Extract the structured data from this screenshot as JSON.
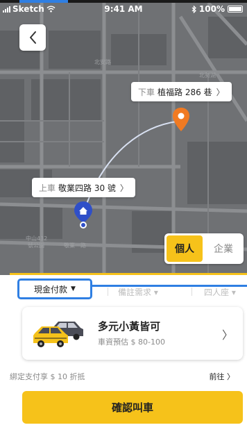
{
  "status_bar": {
    "carrier": "Sketch",
    "time": "9:41 AM",
    "battery": "100%"
  },
  "map": {
    "dropoff": {
      "label": "下車",
      "address": "植福路 286 巷",
      "chevron": "〉"
    },
    "pickup": {
      "label": "上車",
      "address": "敬業四路 30 號",
      "chevron": "〉"
    },
    "street_labels": [
      "北安路",
      "北勢湖",
      "中山432",
      "號公園",
      "敬業一路"
    ]
  },
  "mode_toggle": {
    "options": [
      {
        "label": "個人",
        "active": true
      },
      {
        "label": "企業",
        "active": false
      }
    ]
  },
  "options_row": {
    "payment": {
      "label": "現金付款",
      "caret": "▼"
    },
    "note": "備註需求 ▾",
    "seat": "四人座 ▾"
  },
  "vehicle": {
    "title": "多元小黃皆可",
    "price_estimate": "車資預估 $ 80-100",
    "chevron": "〉"
  },
  "promo": {
    "text": "綁定支付享 $ 10 折抵",
    "link": "前往 〉"
  },
  "confirm_label": "確認叫車",
  "colors": {
    "accent_yellow": "#f6c21a",
    "highlight_blue": "#2f7fe3",
    "dropoff_orange": "#f07a22",
    "pickup_blue": "#2f4fc8"
  },
  "icons": [
    "back-chevron-icon",
    "signal-icon",
    "wifi-icon",
    "bluetooth-icon",
    "battery-icon",
    "dropoff-pin-icon",
    "pickup-pin-icon",
    "taxi-cars-icon"
  ]
}
